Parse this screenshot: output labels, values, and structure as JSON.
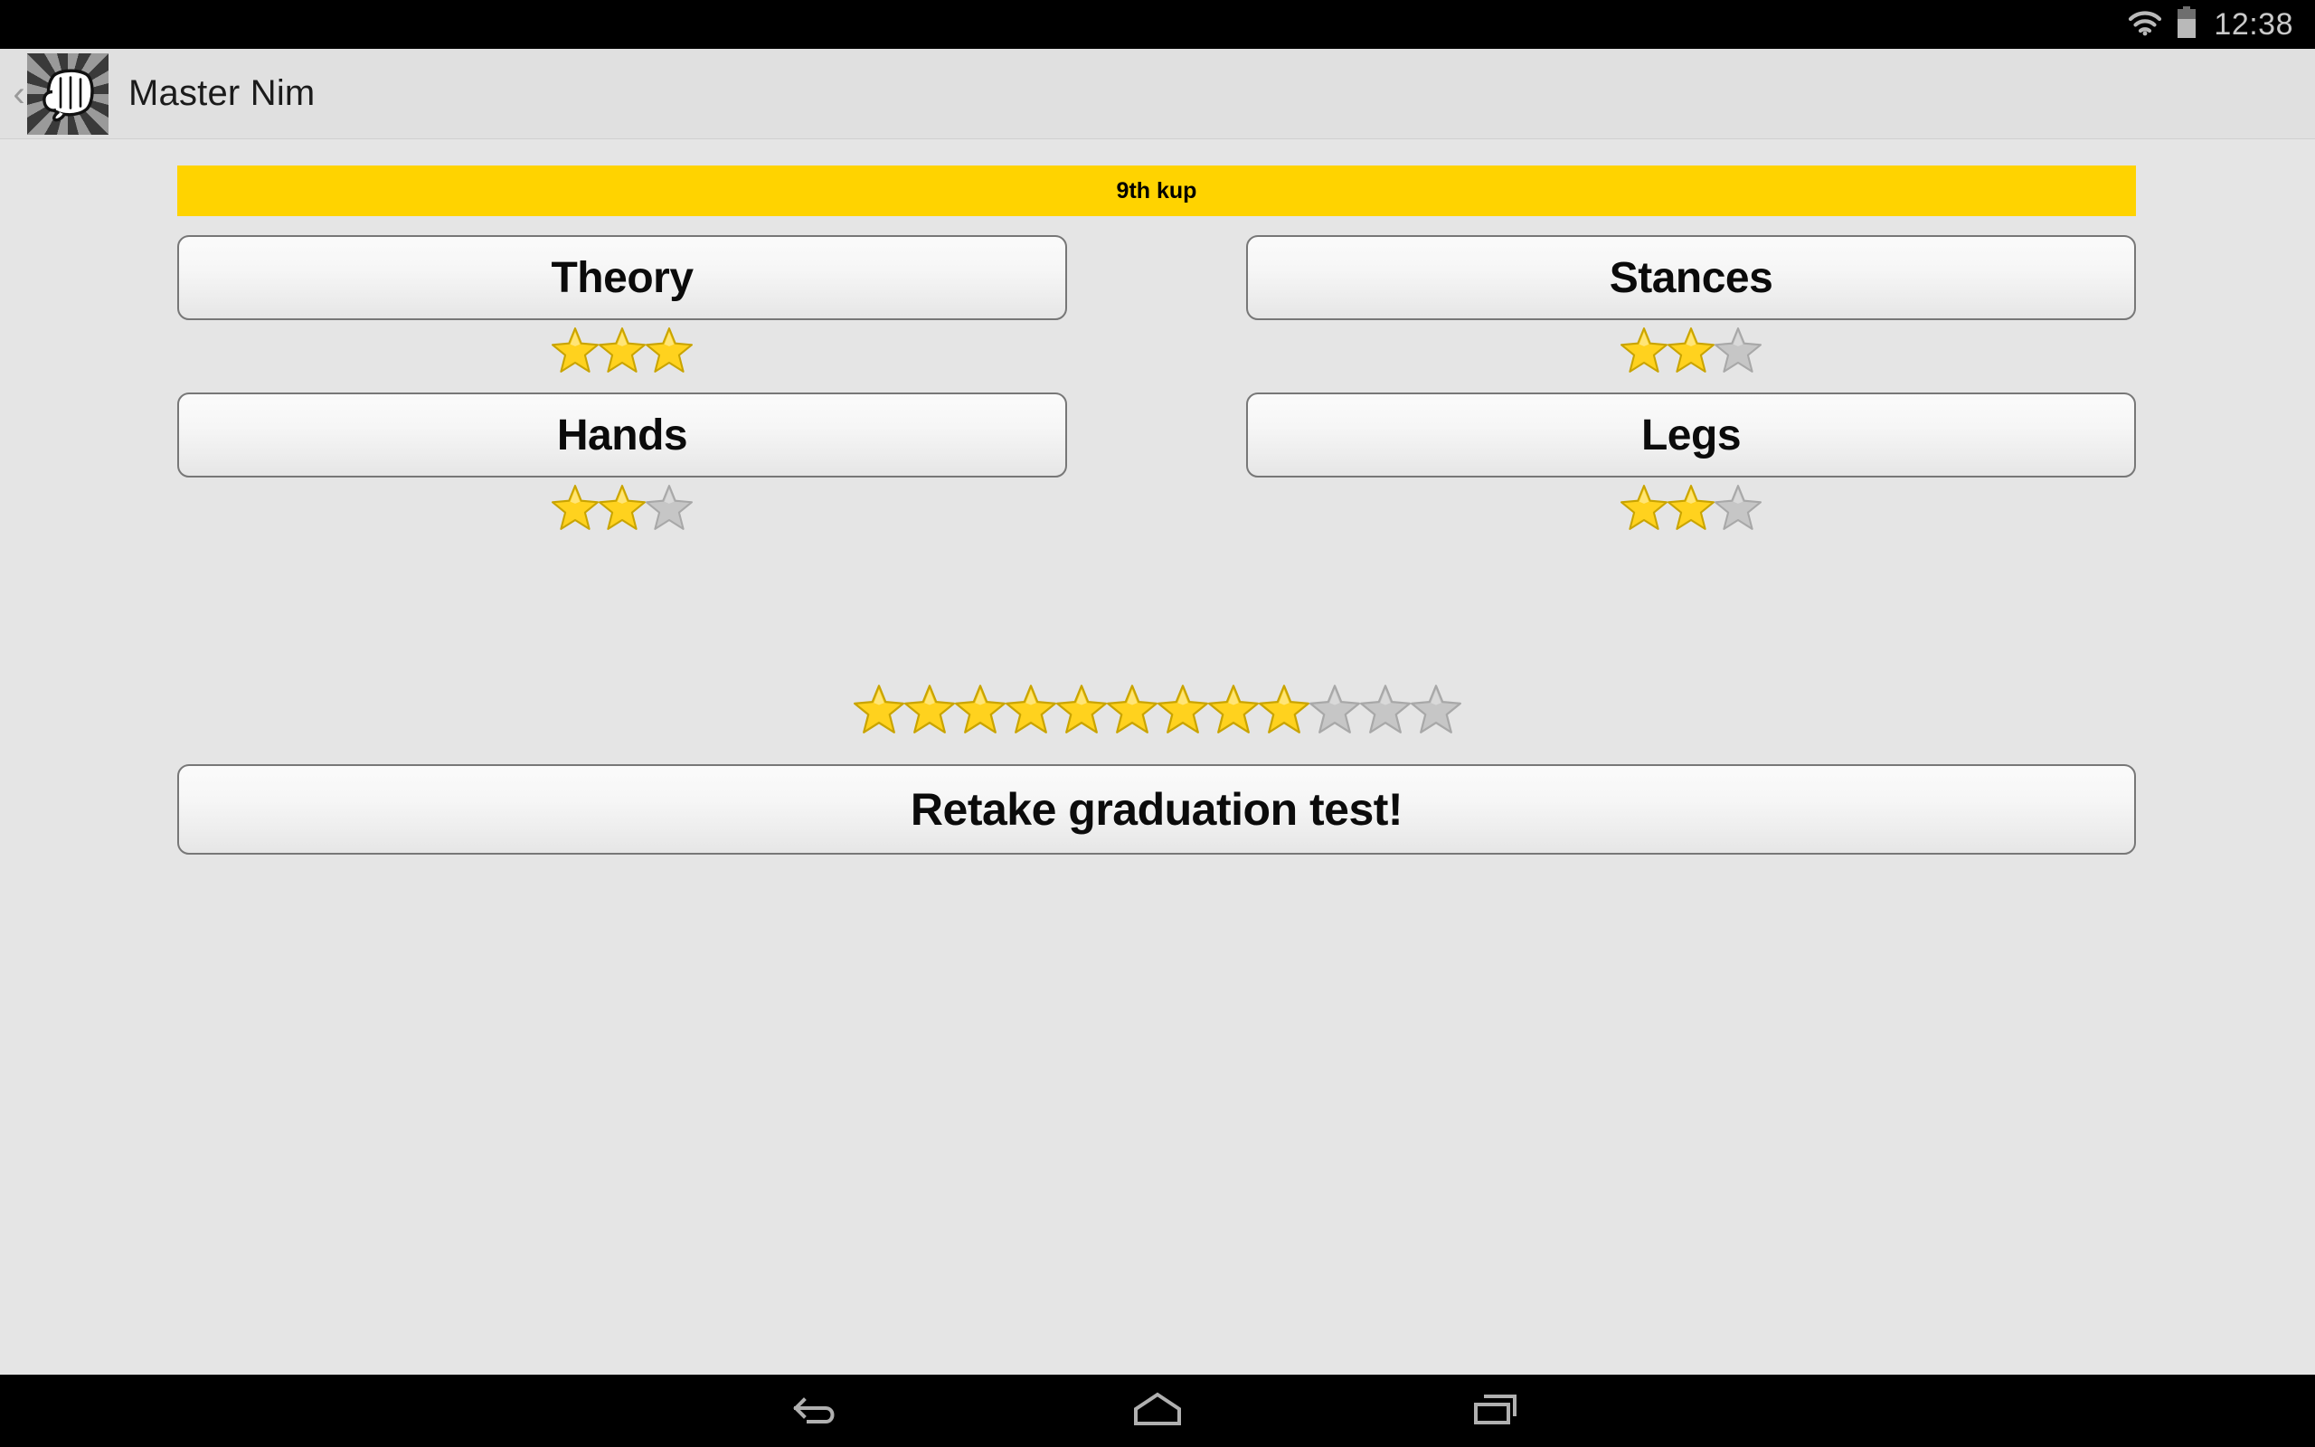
{
  "status_bar": {
    "clock": "12:38",
    "icons": [
      "wifi-icon",
      "battery-icon"
    ],
    "background_color": "#000000",
    "text_color": "#c9c9c9"
  },
  "action_bar": {
    "back_chevron": "‹",
    "app_icon_name": "fist-app-icon",
    "title": "Master Nim",
    "background_color": "#e0e0e0"
  },
  "content": {
    "background_color": "#e5e5e5",
    "rank_banner": {
      "label": "9th kup",
      "background_color": "#ffd300",
      "text_color": "#000000"
    },
    "skills": [
      {
        "label": "Theory",
        "stars_filled": 3,
        "stars_total": 3
      },
      {
        "label": "Stances",
        "stars_filled": 2,
        "stars_total": 3
      },
      {
        "label": "Hands",
        "stars_filled": 2,
        "stars_total": 3
      },
      {
        "label": "Legs",
        "stars_filled": 2,
        "stars_total": 3
      }
    ],
    "overall_progress": {
      "stars_filled": 9,
      "stars_total": 12
    },
    "retake_button": {
      "label": "Retake graduation test!"
    },
    "star_filled_color": "#ffd21e",
    "star_empty_color": "#c6c6c6"
  },
  "nav_bar": {
    "background_color": "#000000",
    "buttons": [
      {
        "name": "back-icon"
      },
      {
        "name": "home-icon"
      },
      {
        "name": "recents-icon"
      }
    ]
  }
}
